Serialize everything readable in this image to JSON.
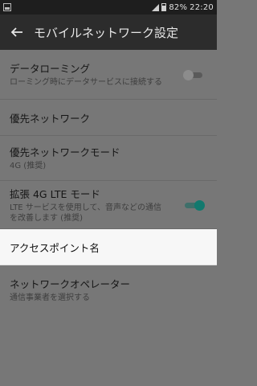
{
  "status_bar": {
    "battery_percent": "82%",
    "time": "22:20"
  },
  "app_bar": {
    "title": "モバイルネットワーク設定"
  },
  "settings": [
    {
      "title": "データローミング",
      "subtitle": "ローミング時にデータサービスに接続する",
      "toggle": "off"
    },
    {
      "title": "優先ネットワーク"
    },
    {
      "title": "優先ネットワークモード",
      "subtitle": "4G (推奨)"
    },
    {
      "title": "拡張 4G LTE モード",
      "subtitle": "LTE サービスを使用して、音声などの通信を改善します (推奨)",
      "toggle": "on"
    },
    {
      "title": "アクセスポイント名"
    },
    {
      "title": "ネットワークオペレーター",
      "subtitle": "通信事業者を選択する"
    }
  ],
  "colors": {
    "accent_teal": "#12796e",
    "dim_overlay": "#777777",
    "highlight_row": "#f7f7f7"
  }
}
